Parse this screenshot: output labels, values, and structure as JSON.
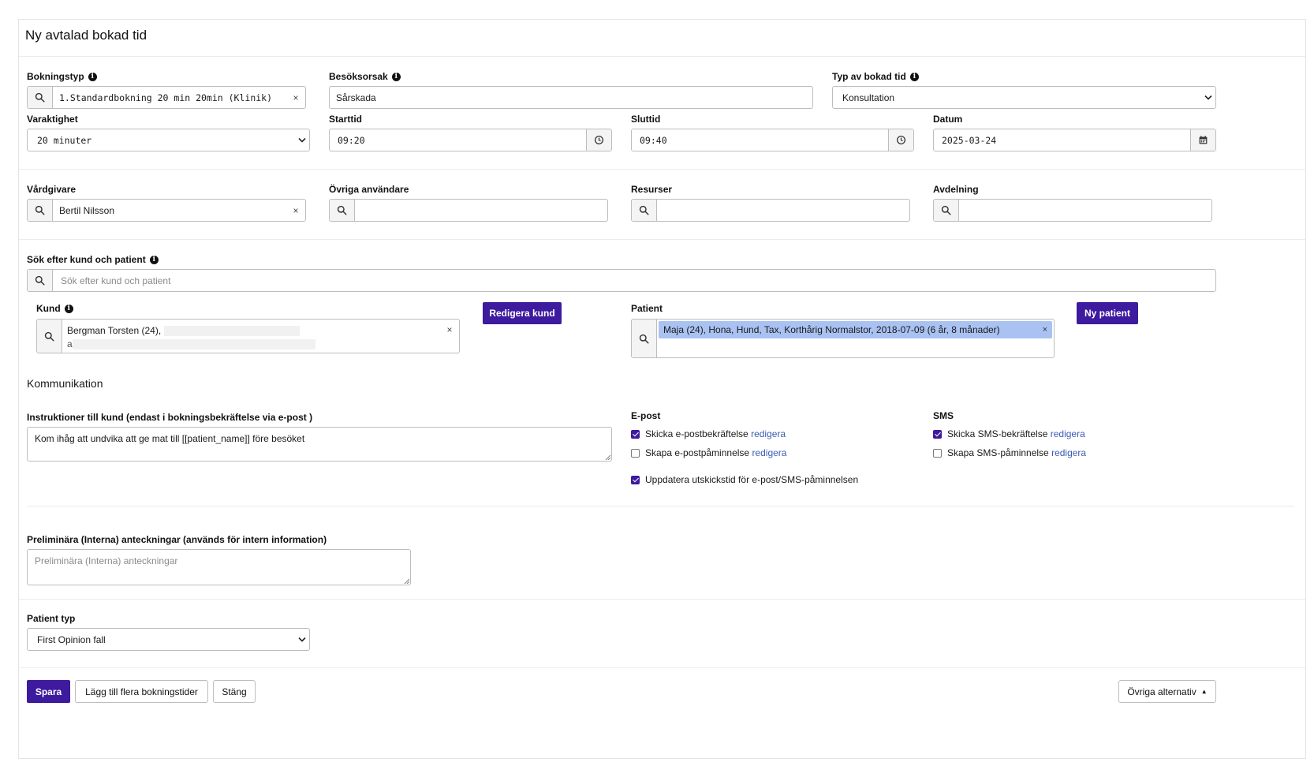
{
  "page": {
    "title": "Ny avtalad bokad tid"
  },
  "booking": {
    "bokningstyp": {
      "label": "Bokningstyp",
      "value": "1.Standardbokning 20 min 20min (Klinik)"
    },
    "besoksorsak": {
      "label": "Besöksorsak",
      "value": "Sårskada"
    },
    "typ_av_bokad_tid": {
      "label": "Typ av bokad tid",
      "value": "Konsultation"
    },
    "varaktighet": {
      "label": "Varaktighet",
      "value": "20 minuter"
    },
    "starttid": {
      "label": "Starttid",
      "value": "09:20"
    },
    "sluttid": {
      "label": "Sluttid",
      "value": "09:40"
    },
    "datum": {
      "label": "Datum",
      "value": "2025-03-24"
    }
  },
  "staff": {
    "vardgivare": {
      "label": "Vårdgivare",
      "value": "Bertil Nilsson"
    },
    "ovriga": {
      "label": "Övriga användare",
      "value": ""
    },
    "resurser": {
      "label": "Resurser",
      "value": ""
    },
    "avdelning": {
      "label": "Avdelning",
      "value": ""
    }
  },
  "search": {
    "label": "Sök efter kund och patient",
    "placeholder": "Sök efter kund och patient"
  },
  "kund": {
    "label": "Kund",
    "value_line1": "Bergman Torsten (24),",
    "value_line2": "a",
    "edit_button": "Redigera kund"
  },
  "patient": {
    "label": "Patient",
    "tag": "Maja (24), Hona, Hund, Tax, Korthårig Normalstor, 2018-07-09 (6 år, 8 månader)",
    "new_button": "Ny patient"
  },
  "kommunikation": {
    "heading": "Kommunikation",
    "instructions_label": "Instruktioner till kund (endast i bokningsbekräftelse via e-post )",
    "instructions_value": "Kom ihåg att undvika att ge mat till [[patient_name]] före besöket",
    "epost": {
      "heading": "E-post",
      "confirm": {
        "text": "Skicka e-postbekräftelse",
        "link": "redigera",
        "checked": true
      },
      "reminder": {
        "text": "Skapa e-postpåminnelse",
        "link": "redigera",
        "checked": false
      },
      "update": {
        "text": "Uppdatera utskickstid för e-post/SMS-påminnelsen",
        "checked": true
      }
    },
    "sms": {
      "heading": "SMS",
      "confirm": {
        "text": "Skicka SMS-bekräftelse",
        "link": "redigera",
        "checked": true
      },
      "reminder": {
        "text": "Skapa SMS-påminnelse",
        "link": "redigera",
        "checked": false
      }
    }
  },
  "notes": {
    "label": "Preliminära (Interna) anteckningar (används för intern information)",
    "placeholder": "Preliminära (Interna) anteckningar"
  },
  "patient_typ": {
    "label": "Patient typ",
    "value": "First Opinion fall"
  },
  "footer": {
    "save": "Spara",
    "add_more": "Lägg till flera bokningstider",
    "close": "Stäng",
    "other": "Övriga alternativ"
  },
  "colors": {
    "primary": "#3d1a9e",
    "link": "#3b5bb5",
    "tag": "#a9c2f2"
  }
}
